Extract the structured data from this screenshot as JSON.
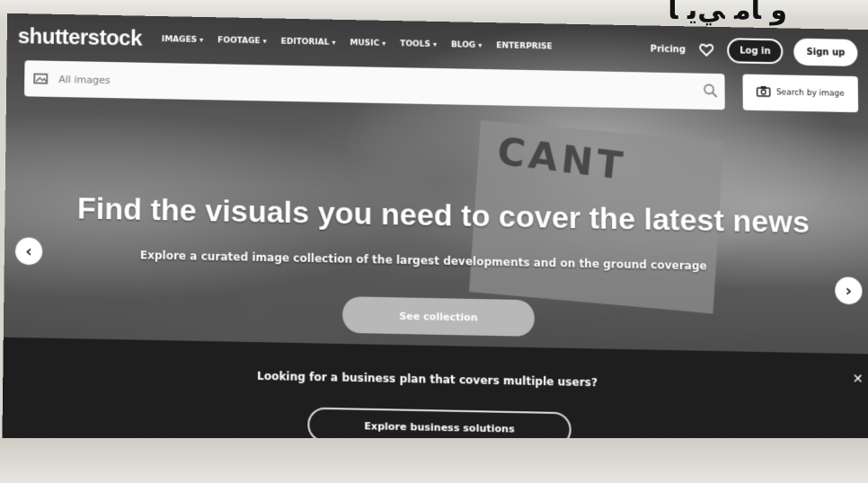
{
  "nav": {
    "logo": "shutterstock",
    "items": [
      {
        "label": "IMAGES",
        "caret": "▾"
      },
      {
        "label": "FOOTAGE",
        "caret": "▾"
      },
      {
        "label": "EDITORIAL",
        "caret": "▾"
      },
      {
        "label": "MUSIC",
        "caret": "▾"
      },
      {
        "label": "TOOLS",
        "caret": "▾"
      },
      {
        "label": "BLOG",
        "caret": "▾"
      },
      {
        "label": "ENTERPRISE",
        "caret": ""
      }
    ],
    "pricing": "Pricing",
    "login": "Log in",
    "signup": "Sign up"
  },
  "search": {
    "placeholder": "All images",
    "search_by_image": "Search by image"
  },
  "hero": {
    "headline": "Find the visuals you need to cover the latest news",
    "subline": "Explore a curated image collection of the largest developments and on the ground coverage",
    "cta": "See collection",
    "sign_text": "CANT"
  },
  "banner": {
    "text": "Looking for a business plan that covers multiple users?",
    "button": "Explore business solutions",
    "close": "✕"
  },
  "icons": {
    "arrow_left": "‹",
    "arrow_right": "›"
  }
}
